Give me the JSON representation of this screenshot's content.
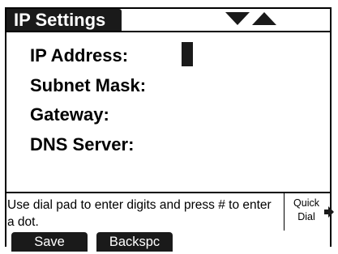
{
  "screen": {
    "title": "IP Settings",
    "fields": [
      {
        "label": "IP Address:"
      },
      {
        "label": "Subnet Mask:"
      },
      {
        "label": "Gateway:"
      },
      {
        "label": "DNS Server:"
      }
    ],
    "hint": "Use dial pad to enter digits and press # to enter a dot.",
    "quick_dial": {
      "line1": "Quick",
      "line2": "Dial"
    }
  },
  "softkeys": {
    "save_label": "Save",
    "backspace_label": "Backspc"
  },
  "icons": {
    "nav": "up-down-arrows-icon",
    "quick_dial_arrow": "arrow-right-icon"
  },
  "colors": {
    "bar": "#1a1a1a",
    "text": "#000000",
    "background": "#ffffff"
  }
}
